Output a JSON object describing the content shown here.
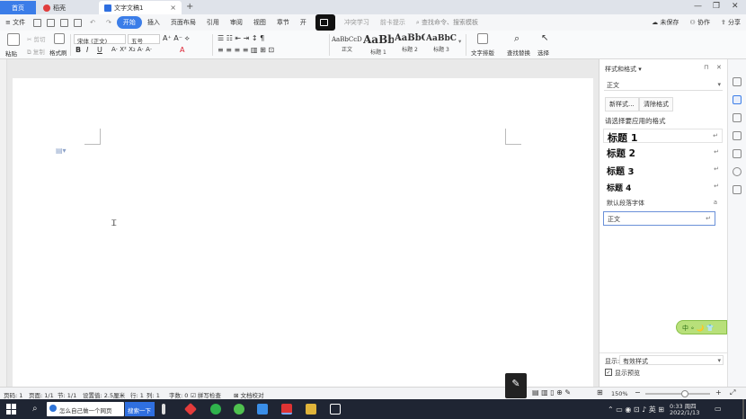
{
  "titlebar": {
    "tabs": [
      {
        "label": "首页"
      },
      {
        "label": "稻壳"
      },
      {
        "label": "文字文稿1"
      }
    ],
    "add_symbol": "+",
    "close_symbol": "×",
    "window_controls": [
      "—",
      "❐",
      "✕"
    ]
  },
  "menubar": {
    "file": "≡ 文件",
    "items": [
      "开始",
      "插入",
      "页面布局",
      "引用",
      "审阅",
      "视图",
      "章节",
      "开"
    ],
    "active": "开始",
    "doc_tags": [
      "冲突学习",
      "前卡提示"
    ],
    "search_placeholder": "查找命令、搜索模板",
    "right": [
      "未保存",
      "协作",
      "分享"
    ]
  },
  "ribbon": {
    "paste": "粘贴",
    "cut": "剪切",
    "copy": "复制",
    "format_painter": "格式刷",
    "font_name": "宋体 (正文)",
    "font_size": "五号",
    "styles": [
      {
        "sample": "AaBbCcDd",
        "name": "正文"
      },
      {
        "sample": "AaBb",
        "name": "标题 1"
      },
      {
        "sample": "AaBbC",
        "name": "标题 2"
      },
      {
        "sample": "AaBbC",
        "name": "标题 3"
      }
    ],
    "text_layout": "文字排版",
    "find_replace": "查找替换",
    "select": "选择"
  },
  "panel": {
    "title": "样式和格式",
    "current_style": "正文",
    "new_style": "新样式...",
    "clear_format": "清除格式",
    "prompt": "请选择要应用的格式",
    "headings": [
      "标题 1",
      "标题 2",
      "标题 3",
      "标题 4"
    ],
    "default_font": "默认段落字体",
    "default_font_mark": "a",
    "normal_item": "正文",
    "display_label": "显示:",
    "display_value": "有效样式",
    "preview_checkbox": "显示预览",
    "float_widget": "中 ∘ 🌙 👕"
  },
  "statusbar": {
    "page": "页码: 1",
    "pages": "页面: 1/1",
    "section": "节: 1/1",
    "setting": "设置值: 2.5厘米",
    "row": "行: 1",
    "col": "列: 1",
    "words": "字数: 0",
    "spell": "拼写检查",
    "proof": "文档校对",
    "zoom": "150%"
  },
  "taskbar": {
    "search_text": "怎么自己做一个网页",
    "search_button": "搜索一下",
    "time": "0:33 周四",
    "date": "2022/1/13"
  },
  "colors": {
    "accent": "#3b7de8",
    "taskbar": "#1f2533"
  }
}
